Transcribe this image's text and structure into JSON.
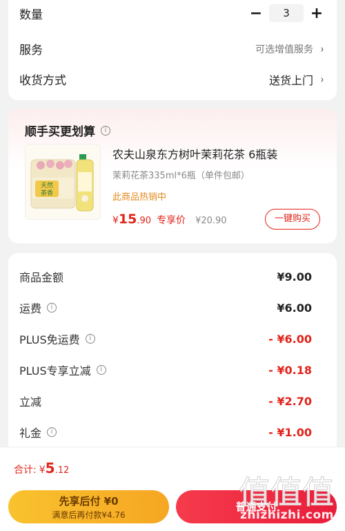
{
  "options": {
    "quantity_label": "数量",
    "quantity_value": "3",
    "minus": "−",
    "plus": "+",
    "service_label": "服务",
    "service_value": "可选增值服务",
    "delivery_label": "收货方式",
    "delivery_value": "送货上门",
    "chevron": "›"
  },
  "promo": {
    "title": "顺手买更划算",
    "info": "i",
    "product_title": "农夫山泉东方树叶茉莉花茶 6瓶装",
    "product_spec": "茉莉花茶335ml*6瓶（单件包邮）",
    "hot_label": "此商品热销中",
    "price_yen": "¥",
    "price_int": "15",
    "price_dec": ".90",
    "price_tag": "专享价",
    "price_original": "¥20.90",
    "buy_button": "一键购买",
    "image_badge_text": "天然茶香"
  },
  "fees": [
    {
      "label": "商品金额",
      "value": "¥9.00",
      "info": false,
      "highlight": false
    },
    {
      "label": "运费",
      "value": "¥6.00",
      "info": true,
      "highlight": false
    },
    {
      "label": "PLUS免运费",
      "value": "- ¥6.00",
      "info": true,
      "highlight": true
    },
    {
      "label": "PLUS专享立减",
      "value": "- ¥0.18",
      "info": true,
      "highlight": true
    },
    {
      "label": "立减",
      "value": "- ¥2.70",
      "info": false,
      "highlight": true
    },
    {
      "label": "礼金",
      "value": "- ¥1.00",
      "info": true,
      "highlight": true
    }
  ],
  "bottom": {
    "total_label": "合计:",
    "total_yen": "¥",
    "total_int": "5",
    "total_dec": ".12",
    "pay_later_title": "先享后付 ¥0",
    "pay_later_sub": "满意后再付款¥4.76",
    "pay_now": "普通支付"
  },
  "watermark": {
    "glyphs": "值值值",
    "site": "zhizhizhi.com"
  },
  "colors": {
    "accent_red": "#e2231a",
    "hot_orange": "#e48a1c",
    "pay_later_yellow": "#f6a623",
    "pay_now_red": "#e91d3a"
  }
}
